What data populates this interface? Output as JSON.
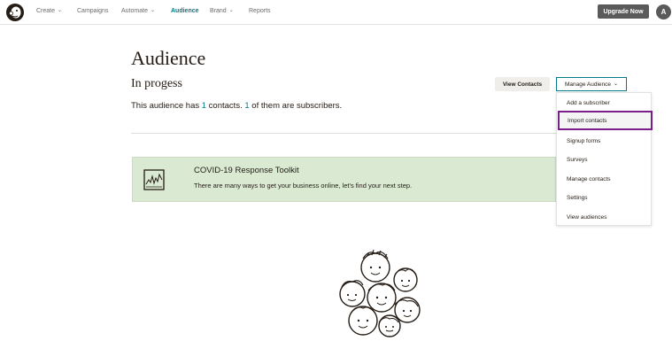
{
  "nav": {
    "items": [
      {
        "label": "Create",
        "dropdown": true
      },
      {
        "label": "Campaigns",
        "dropdown": false
      },
      {
        "label": "Automate",
        "dropdown": true
      },
      {
        "label": "Audience",
        "dropdown": false,
        "active": true
      },
      {
        "label": "Brand",
        "dropdown": true
      },
      {
        "label": "Reports",
        "dropdown": false
      }
    ],
    "upgrade_label": "Upgrade Now",
    "avatar_initial": "A",
    "logo_icon": "mailchimp-freddie-icon"
  },
  "page": {
    "title": "Audience",
    "audience_name": "In progess",
    "summary": {
      "prefix": "This audience has ",
      "contacts_count": "1",
      "mid": " contacts. ",
      "subscribers_count": "1",
      "suffix": " of them are subscribers."
    }
  },
  "actions": {
    "view_contacts_label": "View Contacts",
    "manage_audience_label": "Manage Audience"
  },
  "dropdown": {
    "items": [
      {
        "label": "Add a subscriber"
      },
      {
        "label": "Import contacts",
        "highlighted": true
      },
      {
        "label": "Signup forms"
      },
      {
        "label": "Surveys"
      },
      {
        "label": "Manage contacts"
      },
      {
        "label": "Settings"
      },
      {
        "label": "View audiences"
      }
    ]
  },
  "banner": {
    "title": "COVID-19 Response Toolkit",
    "text": "There are many ways to get your business online, let's find your next step.",
    "icon": "chart-trend-icon"
  },
  "colors": {
    "accent": "#007c89",
    "banner_bg": "#d9e9d2",
    "highlight_border": "#7a1f8a",
    "dark_button": "#5a5a5a"
  }
}
